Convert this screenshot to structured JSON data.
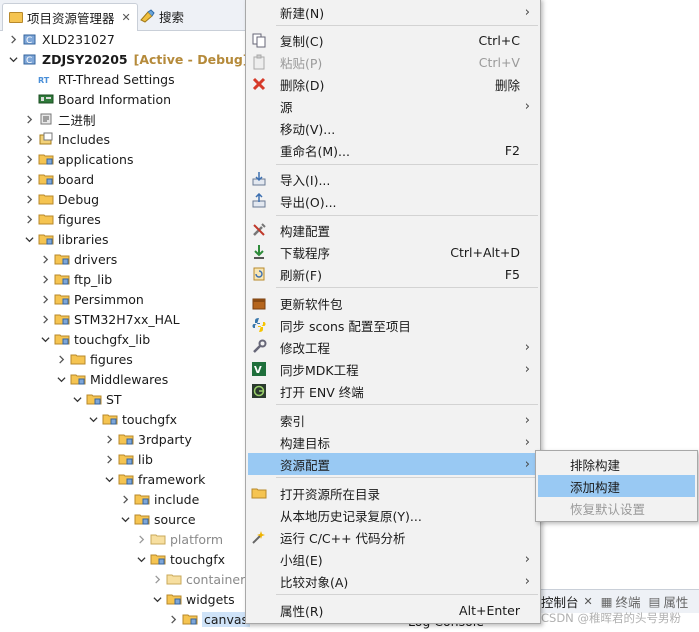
{
  "tabs": {
    "project_explorer": "项目资源管理器",
    "search": "搜索"
  },
  "tree": {
    "items": [
      {
        "label": "XLD231027"
      },
      {
        "label": "ZDJSY20205",
        "status": "[Active - Debug]"
      },
      {
        "label": "RT-Thread Settings"
      },
      {
        "label": "Board Information"
      },
      {
        "label": "二进制"
      },
      {
        "label": "Includes"
      },
      {
        "label": "applications"
      },
      {
        "label": "board"
      },
      {
        "label": "Debug"
      },
      {
        "label": "figures"
      },
      {
        "label": "libraries"
      },
      {
        "label": "drivers"
      },
      {
        "label": "ftp_lib"
      },
      {
        "label": "Persimmon"
      },
      {
        "label": "STM32H7xx_HAL"
      },
      {
        "label": "touchgfx_lib"
      },
      {
        "label": "figures"
      },
      {
        "label": "Middlewares"
      },
      {
        "label": "ST"
      },
      {
        "label": "touchgfx"
      },
      {
        "label": "3rdparty"
      },
      {
        "label": "lib"
      },
      {
        "label": "framework"
      },
      {
        "label": "include"
      },
      {
        "label": "source"
      },
      {
        "label": "platform"
      },
      {
        "label": "touchgfx"
      },
      {
        "label": "containers"
      },
      {
        "label": "widgets"
      },
      {
        "label": "canvas"
      }
    ]
  },
  "menu": {
    "items": [
      {
        "label": "新建(N)",
        "shortcut": "",
        "arrow": "›"
      },
      {
        "label": "复制(C)",
        "shortcut": "Ctrl+C",
        "arrow": ""
      },
      {
        "label": "粘贴(P)",
        "shortcut": "Ctrl+V",
        "arrow": ""
      },
      {
        "label": "删除(D)",
        "shortcut": "删除",
        "arrow": ""
      },
      {
        "label": "源",
        "shortcut": "",
        "arrow": "›"
      },
      {
        "label": "移动(V)...",
        "shortcut": "",
        "arrow": ""
      },
      {
        "label": "重命名(M)...",
        "shortcut": "F2",
        "arrow": ""
      },
      {
        "label": "导入(I)...",
        "shortcut": "",
        "arrow": ""
      },
      {
        "label": "导出(O)...",
        "shortcut": "",
        "arrow": ""
      },
      {
        "label": "构建配置",
        "shortcut": "",
        "arrow": ""
      },
      {
        "label": "下载程序",
        "shortcut": "Ctrl+Alt+D",
        "arrow": ""
      },
      {
        "label": "刷新(F)",
        "shortcut": "F5",
        "arrow": ""
      },
      {
        "label": "更新软件包",
        "shortcut": "",
        "arrow": ""
      },
      {
        "label": "同步 scons 配置至项目",
        "shortcut": "",
        "arrow": ""
      },
      {
        "label": "修改工程",
        "shortcut": "",
        "arrow": "›"
      },
      {
        "label": "同步MDK工程",
        "shortcut": "",
        "arrow": "›"
      },
      {
        "label": "打开 ENV 终端",
        "shortcut": "",
        "arrow": ""
      },
      {
        "label": "索引",
        "shortcut": "",
        "arrow": "›"
      },
      {
        "label": "构建目标",
        "shortcut": "",
        "arrow": "›"
      },
      {
        "label": "资源配置",
        "shortcut": "",
        "arrow": "›"
      },
      {
        "label": "打开资源所在目录",
        "shortcut": "",
        "arrow": ""
      },
      {
        "label": "从本地历史记录复原(Y)...",
        "shortcut": "",
        "arrow": ""
      },
      {
        "label": "运行 C/C++ 代码分析",
        "shortcut": "",
        "arrow": ""
      },
      {
        "label": "小组(E)",
        "shortcut": "",
        "arrow": "›"
      },
      {
        "label": "比较对象(A)",
        "shortcut": "",
        "arrow": "›"
      },
      {
        "label": "属性(R)",
        "shortcut": "Alt+Enter",
        "arrow": ""
      }
    ]
  },
  "submenu": {
    "items": [
      {
        "label": "排除构建"
      },
      {
        "label": "添加构建"
      },
      {
        "label": "恢复默认设置"
      }
    ]
  },
  "bottom": {
    "console_tab": "控制台",
    "problems_tab": "终端",
    "properties_tab": "属性",
    "log_console": "Log Console",
    "watermark": "CSDN @稚晖君的头号男粉"
  },
  "colors": {
    "highlight": "#99c9f3",
    "menu_bg": "#f2f2f2",
    "debug_label": "#b58a3a"
  }
}
